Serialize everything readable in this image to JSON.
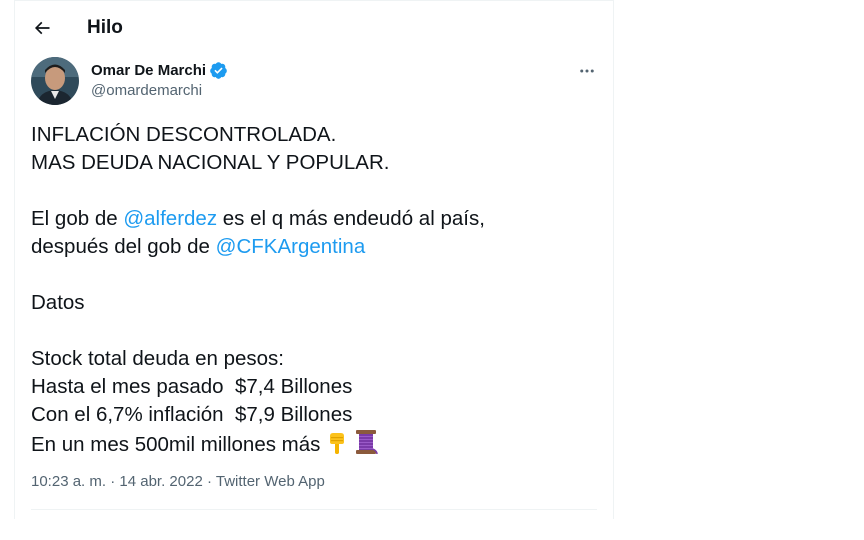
{
  "header": {
    "title": "Hilo",
    "back_icon": "arrow-left-icon"
  },
  "author": {
    "name": "Omar De Marchi",
    "handle": "@omardemarchi",
    "verified": true,
    "verified_color": "#1d9bf0",
    "avatar_icon": "profile-photo"
  },
  "tweet": {
    "line1": "INFLACIÓN DESCONTROLADA.",
    "line2": "MAS DEUDA NACIONAL Y POPULAR.",
    "line3_prefix": "El gob de ",
    "line3_mention": "@alferdez",
    "line3_suffix": " es el q más endeudó al país,",
    "line4_prefix": "después del gob de ",
    "line4_mention": "@CFKArgentina",
    "line5": "Datos",
    "line6": "Stock total deuda en pesos:",
    "line7": "Hasta el mes pasado  $7,4 Billones",
    "line8": "Con el 6,7% inflación  $7,9 Billones",
    "line9": "En un mes 500mil millones más",
    "emojis": [
      "backhand-index-pointing-down-icon",
      "thread-spool-icon"
    ],
    "mention_color": "#1d9bf0"
  },
  "meta": {
    "time": "10:23 a. m.",
    "sep1": " · ",
    "date": "14 abr. 2022",
    "sep2": " · ",
    "source": "Twitter Web App"
  }
}
